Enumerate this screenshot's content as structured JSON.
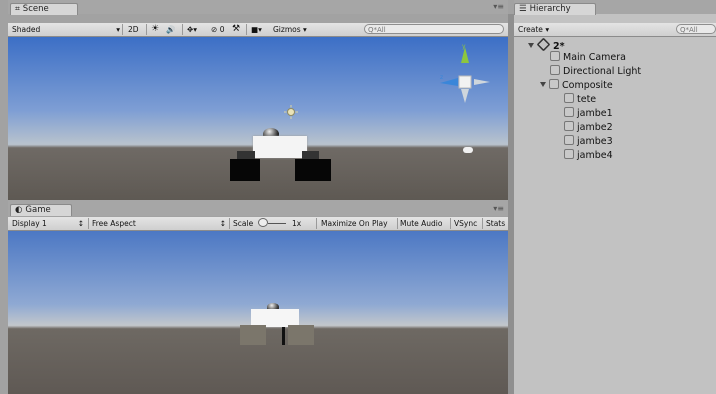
{
  "scene": {
    "tab_label": "Scene",
    "tab_icon": "scene-grid-icon",
    "toolbar": {
      "shading": "Shaded",
      "mode_2d": "2D",
      "effects_count": "0",
      "gizmos": "Gizmos",
      "search_placeholder": "Q*All"
    }
  },
  "game": {
    "tab_label": "Game",
    "tab_icon": "game-controller-icon",
    "toolbar": {
      "display": "Display 1",
      "aspect": "Free Aspect",
      "scale_label": "Scale",
      "scale_value": "1x",
      "maximize": "Maximize On Play",
      "mute": "Mute Audio",
      "vsync": "VSync",
      "stats": "Stats"
    }
  },
  "hierarchy": {
    "tab_label": "Hierarchy",
    "tab_icon": "list-icon",
    "create_label": "Create",
    "search_placeholder": "Q*All",
    "scene_name": "2*",
    "items": [
      {
        "label": "Main Camera"
      },
      {
        "label": "Directional Light"
      },
      {
        "label": "Composite"
      },
      {
        "label": "tete"
      },
      {
        "label": "jambe1"
      },
      {
        "label": "jambe2"
      },
      {
        "label": "jambe3"
      },
      {
        "label": "jambe4"
      }
    ]
  },
  "colors": {
    "panel_bg": "#a2a2a2",
    "tab_bg": "#d6d6d6",
    "toolbar_bg": "#d8d8d8",
    "gizmo_y": "#8dc63f",
    "gizmo_x": "#3a86d9"
  }
}
